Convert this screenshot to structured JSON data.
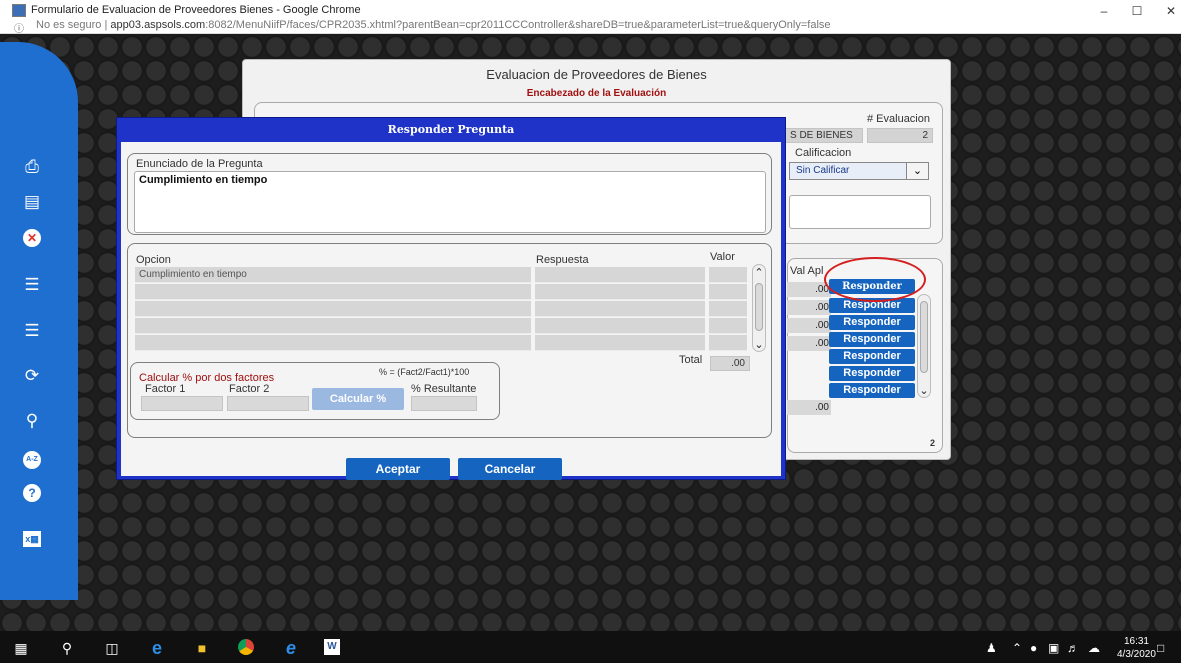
{
  "window": {
    "title": "Formulario de Evaluacion de Proveedores Bienes - Google Chrome",
    "minimize": "–",
    "maximize": "☐",
    "close": "✕"
  },
  "address_bar": {
    "security": "No es seguro",
    "separator": "|",
    "host": "app03.aspsols.com",
    "path": ":8082/MenuNiifP/faces/CPR2035.xhtml?parentBean=cpr2011CCController&shareDB=true&parameterList=true&queryOnly=false"
  },
  "sidebar": {
    "icons": [
      "print-icon",
      "save-icon",
      "delete-icon",
      "db-add-icon",
      "db-icon",
      "refresh-icon",
      "search-doc-icon",
      "sort-az-icon",
      "help-icon",
      "excel-icon"
    ]
  },
  "background_form": {
    "title": "Evaluacion de Proveedores de Bienes",
    "subtitle": "Encabezado de la Evaluación",
    "evaluacion_label": "# Evaluacion",
    "evaluacion_value": "2",
    "type_value": "S DE BIENES",
    "calificacion_label": "Calificacion",
    "calificacion_value": "Sin Calificar",
    "val_apl_label": "Val Apl",
    "val_apl_values": [
      ".00",
      ".00",
      ".00",
      ".00"
    ],
    "total_value": ".00",
    "responder_buttons": [
      "Responder",
      "Responder",
      "Responder",
      "Responder",
      "Responder",
      "Responder",
      "Responder"
    ],
    "page_count": "2"
  },
  "dialog": {
    "title": "Responder Pregunta",
    "question_label": "Enunciado de la Pregunta",
    "question_text": "Cumplimiento en tiempo",
    "columns": {
      "opcion": "Opcion",
      "respuesta": "Respuesta",
      "valor": "Valor"
    },
    "rows": [
      {
        "opcion": "Cumplimiento en tiempo"
      },
      {
        "opcion": ""
      },
      {
        "opcion": ""
      },
      {
        "opcion": ""
      },
      {
        "opcion": ""
      }
    ],
    "total_label": "Total",
    "total_value": ".00",
    "calc": {
      "title": "Calcular % por dos factores",
      "formula": "% = (Fact2/Fact1)*100",
      "factor1_label": "Factor 1",
      "factor2_label": "Factor 2",
      "button": "Calcular %",
      "result_label": "% Resultante"
    },
    "accept": "Aceptar",
    "cancel": "Cancelar"
  },
  "taskbar": {
    "time": "16:31",
    "date": "4/3/2020"
  }
}
